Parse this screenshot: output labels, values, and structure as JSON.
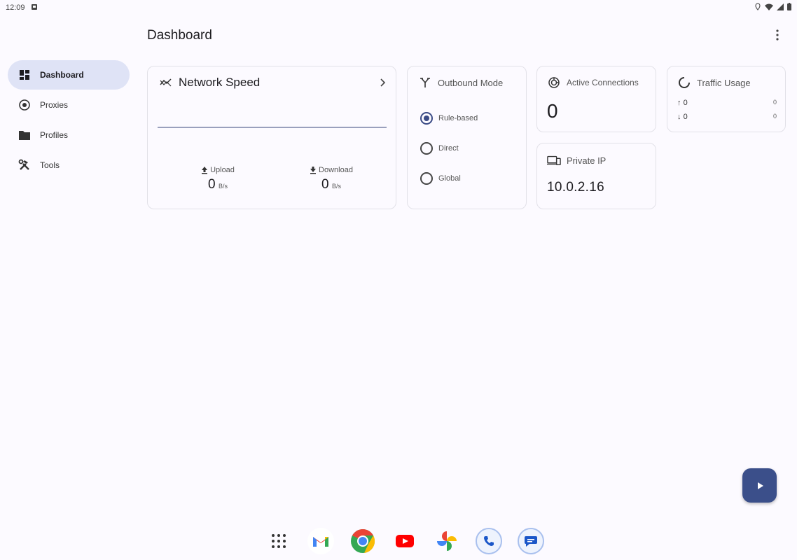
{
  "status_bar": {
    "time": "12:09"
  },
  "header": {
    "title": "Dashboard"
  },
  "nav": {
    "items": [
      {
        "label": "Dashboard",
        "icon": "dashboard-icon"
      },
      {
        "label": "Proxies",
        "icon": "proxies-icon"
      },
      {
        "label": "Profiles",
        "icon": "folder-icon"
      },
      {
        "label": "Tools",
        "icon": "tools-icon"
      }
    ]
  },
  "network_speed": {
    "title": "Network Speed",
    "upload_label": "Upload",
    "upload_value": "0",
    "upload_unit": "B/s",
    "download_label": "Download",
    "download_value": "0",
    "download_unit": "B/s"
  },
  "outbound_mode": {
    "title": "Outbound Mode",
    "options": [
      "Rule-based",
      "Direct",
      "Global"
    ],
    "selected": "Rule-based"
  },
  "active_connections": {
    "title": "Active Connections",
    "value": "0"
  },
  "private_ip": {
    "title": "Private IP",
    "value": "10.0.2.16"
  },
  "traffic_usage": {
    "title": "Traffic Usage",
    "up_arrow": "↑",
    "up_value": "0",
    "up_total": "0",
    "down_arrow": "↓",
    "down_value": "0",
    "down_total": "0"
  },
  "dock": {
    "apps": [
      "app-drawer-icon",
      "gmail-icon",
      "chrome-icon",
      "youtube-icon",
      "photos-icon",
      "phone-icon",
      "messages-icon"
    ]
  },
  "colors": {
    "accent": "#3b4f8a",
    "nav_active_bg": "#dfe3f6",
    "background": "#fcfaff"
  }
}
